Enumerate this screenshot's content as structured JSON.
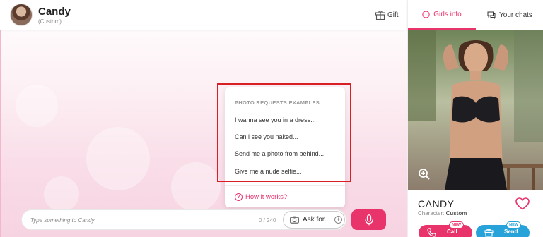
{
  "header": {
    "name": "Candy",
    "subtitle": "(Custom)",
    "gift_label": "Gift"
  },
  "popup": {
    "title": "PHOTO REQUESTS EXAMPLES",
    "items": [
      "I wanna see you in a dress...",
      "Can i see you naked...",
      "Send me a photo from behind...",
      "Give me a nude selfie..."
    ],
    "help_label": "How it works?"
  },
  "input": {
    "placeholder": "Type something to Candy",
    "counter": "0 / 240",
    "ask_label": "Ask for.."
  },
  "sidebar": {
    "tabs": [
      "Girls info",
      "Your chats"
    ],
    "card_name": "CANDY",
    "character_label": "Character:",
    "character_value": "Custom",
    "call_label": "Call",
    "send_label": "Send",
    "new_badge": "NEW"
  },
  "colors": {
    "accent": "#e8336b",
    "secondary": "#27a3d9",
    "highlight_box": "#d81f26"
  }
}
